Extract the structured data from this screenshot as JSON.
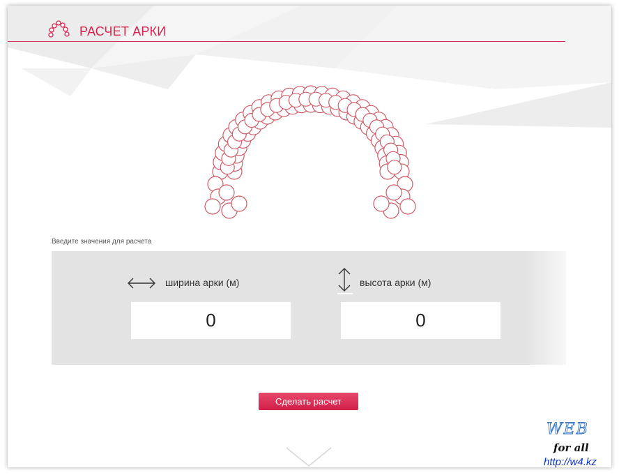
{
  "header": {
    "title": "РАСЧЕТ АРКИ",
    "icon": "balloon-arch-icon"
  },
  "form": {
    "instructions": "Введите значения для расчета",
    "width": {
      "label": "ширина арки (м)",
      "value": "0",
      "icon": "horizontal-arrows-icon"
    },
    "height": {
      "label": "высота арки (м)",
      "value": "0",
      "icon": "vertical-arrows-icon"
    },
    "submit_label": "Сделать расчет"
  },
  "watermark": {
    "brand": "WEB",
    "tagline": "for all",
    "url": "http://w4.kz"
  },
  "colors": {
    "accent": "#d9234f",
    "balloon_stroke": "#d05a66",
    "panel": "#e3e3e3"
  }
}
